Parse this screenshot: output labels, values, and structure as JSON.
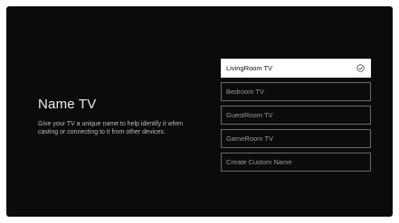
{
  "page": {
    "title": "Name TV",
    "description": "Give your TV a unique name to help identify it when casting or connecting to it from other devices."
  },
  "options": [
    {
      "label": "LivingRoom TV",
      "selected": true,
      "icon": "check-circle-icon"
    },
    {
      "label": "Bedroom TV",
      "selected": false
    },
    {
      "label": "GuestRoom TV",
      "selected": false
    },
    {
      "label": "GameRoom TV",
      "selected": false
    },
    {
      "label": "Create Custom Name",
      "selected": false
    }
  ],
  "colors": {
    "screen_background": "#0b0b0c",
    "selected_background": "#ffffff",
    "option_border": "#6a6a6a"
  }
}
